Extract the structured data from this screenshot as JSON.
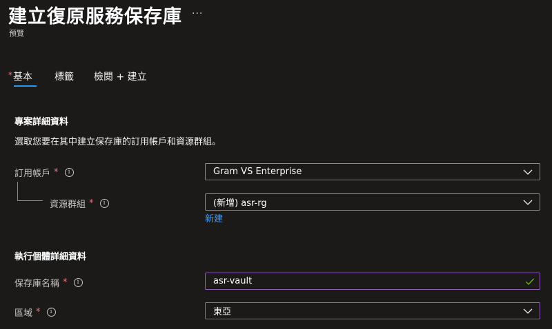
{
  "header": {
    "title": "建立復原服務保存庫",
    "more": "···",
    "subtitle": "預覽"
  },
  "tabs": [
    {
      "label": "基本",
      "required_marker": "*",
      "active": true
    },
    {
      "label": "標籤"
    },
    {
      "label": "檢閱 + 建立"
    }
  ],
  "project_details": {
    "heading": "專案詳細資料",
    "description": "選取您要在其中建立保存庫的訂用帳戶和資源群組。"
  },
  "subscription": {
    "label": "訂用帳戶",
    "required": "*",
    "info": "i",
    "value": "Gram VS Enterprise"
  },
  "resource_group": {
    "label": "資源群組",
    "required": "*",
    "info": "i",
    "value": "(新增) asr-rg",
    "create_new_link": "新建"
  },
  "instance_details": {
    "heading": "執行個體詳細資料"
  },
  "vault_name": {
    "label": "保存庫名稱",
    "required": "*",
    "info": "i",
    "value": "asr-vault",
    "valid": true
  },
  "region": {
    "label": "區域",
    "required": "*",
    "info": "i",
    "value": "東亞"
  },
  "colors": {
    "background": "#1b1a19",
    "accent_link": "#479ef5",
    "tab_underline": "#2899f5",
    "required_star": "#f1707b",
    "valid_check": "#6bb700",
    "focus_border": "#8f5fb4"
  }
}
